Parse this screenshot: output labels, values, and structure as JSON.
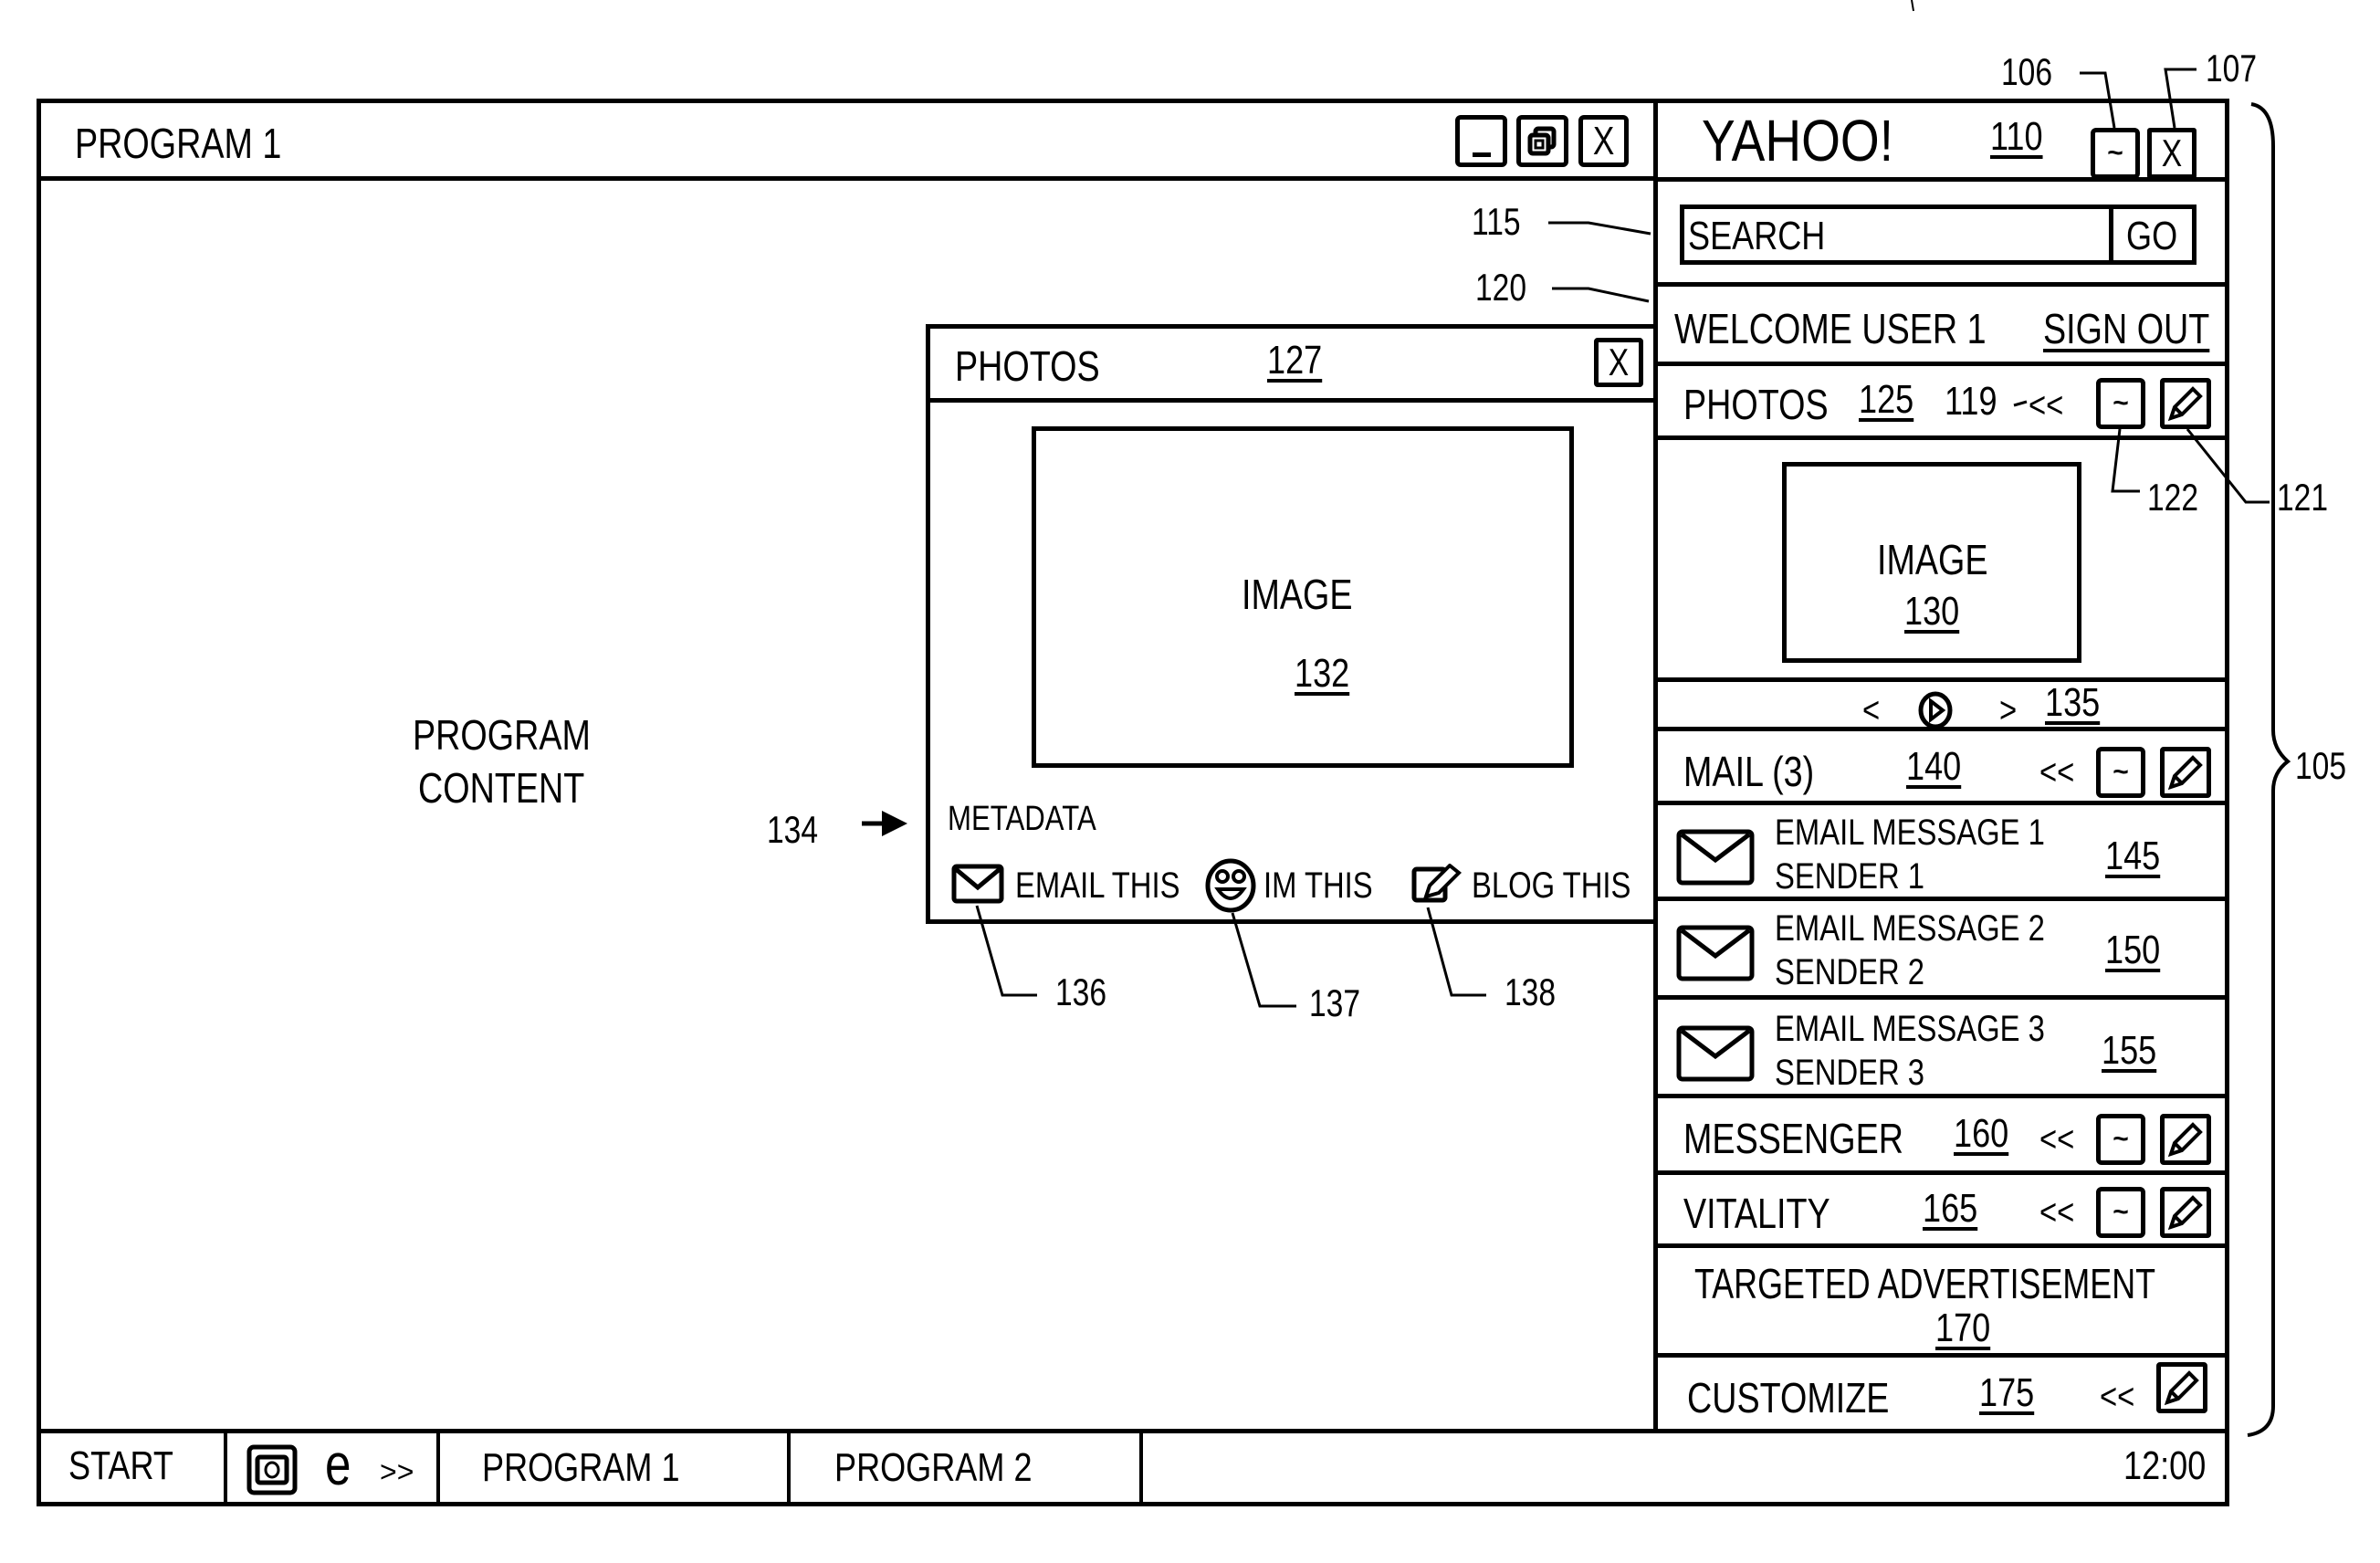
{
  "program_window": {
    "title": "PROGRAM 1",
    "content_text_line1": "PROGRAM",
    "content_text_line2": "CONTENT",
    "controls": {
      "minimize": "minimize",
      "restore": "restore",
      "close": "X"
    }
  },
  "photos_popup": {
    "title": "PHOTOS",
    "ref": "127",
    "close_label": "X",
    "image_label": "IMAGE",
    "image_ref": "132",
    "metadata_label": "METADATA",
    "actions": [
      {
        "label": "EMAIL THIS",
        "icon": "envelope-icon",
        "ref": "136"
      },
      {
        "label": "IM THIS",
        "icon": "smiley-icon",
        "ref": "137"
      },
      {
        "label": "BLOG THIS",
        "icon": "edit-icon",
        "ref": "138"
      }
    ],
    "metadata_ref": "134"
  },
  "sidebar": {
    "brand": "YAHOO!",
    "brand_ref": "110",
    "minimize_label": "~",
    "close_label": "X",
    "minimize_ref": "106",
    "close_ref": "107",
    "sidebar_ref": "105",
    "search": {
      "placeholder": "SEARCH",
      "go_label": "GO",
      "ref": "115"
    },
    "welcome": {
      "text": "WELCOME USER 1",
      "sign_out": "SIGN OUT",
      "ref": "120"
    },
    "photos": {
      "title": "PHOTOS",
      "ref": "125",
      "collapse_ref": "119",
      "collapse_label": "<<",
      "minimize_label": "~",
      "minimize_ref": "122",
      "edit_ref": "121",
      "image_label": "IMAGE",
      "image_ref": "130",
      "nav_prev": "<",
      "nav_next": ">",
      "nav_ref": "135"
    },
    "mail": {
      "title": "MAIL (3)",
      "ref": "140",
      "collapse_label": "<<",
      "minimize_label": "~",
      "messages": [
        {
          "subject": "EMAIL MESSAGE 1",
          "sender": "SENDER 1",
          "ref": "145"
        },
        {
          "subject": "EMAIL MESSAGE 2",
          "sender": "SENDER 2",
          "ref": "150"
        },
        {
          "subject": "EMAIL MESSAGE 3",
          "sender": "SENDER 3",
          "ref": "155"
        }
      ]
    },
    "messenger": {
      "title": "MESSENGER",
      "ref": "160",
      "collapse_label": "<<",
      "minimize_label": "~"
    },
    "vitality": {
      "title": "VITALITY",
      "ref": "165",
      "collapse_label": "<<",
      "minimize_label": "~"
    },
    "advertisement": {
      "title": "TARGETED ADVERTISEMENT",
      "ref": "170"
    },
    "customize": {
      "title": "CUSTOMIZE",
      "ref": "175",
      "collapse_label": "<<"
    }
  },
  "taskbar": {
    "start_label": "START",
    "quicklaunch_more": ">>",
    "quicklaunch_browser": "e",
    "programs": [
      "PROGRAM 1",
      "PROGRAM 2"
    ],
    "clock": "12:00"
  }
}
